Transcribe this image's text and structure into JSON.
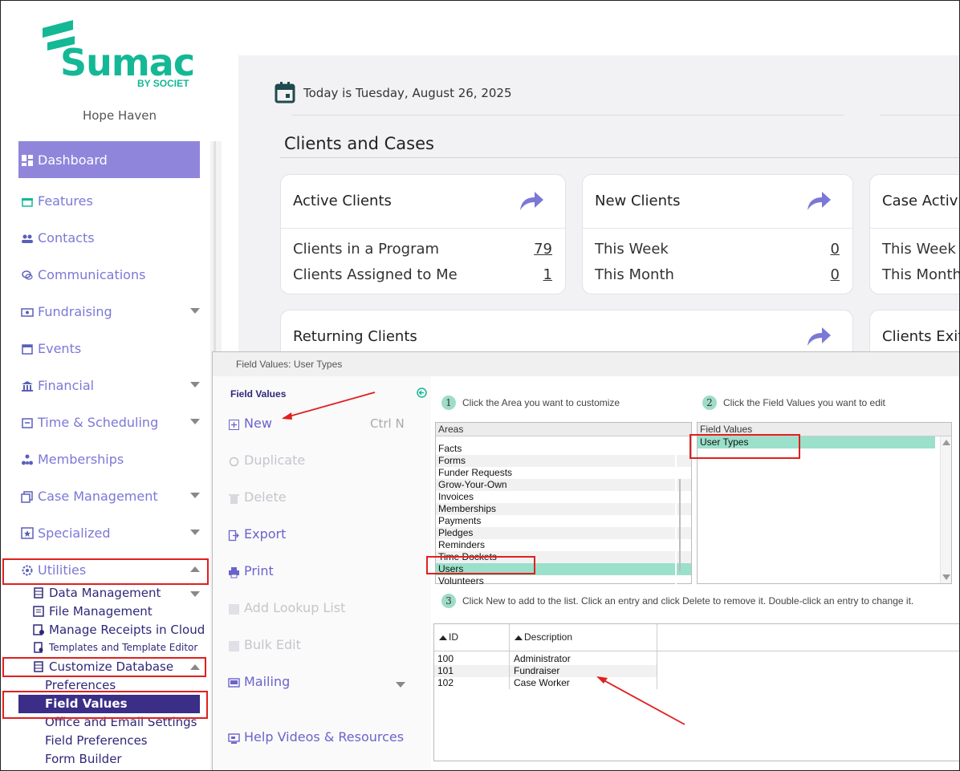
{
  "brand": {
    "name": "Sumac",
    "sub": "BY SOCIET",
    "color": "#14b895"
  },
  "org_name": "Hope Haven",
  "sidebar": {
    "items": [
      {
        "label": "Dashboard",
        "icon": "grid-icon"
      },
      {
        "label": "Features",
        "icon": "gift-icon"
      },
      {
        "label": "Contacts",
        "icon": "people-icon"
      },
      {
        "label": "Communications",
        "icon": "chat-icon"
      },
      {
        "label": "Fundraising",
        "icon": "money-icon"
      },
      {
        "label": "Events",
        "icon": "calendar-icon"
      },
      {
        "label": "Financial",
        "icon": "bank-icon"
      },
      {
        "label": "Time & Scheduling",
        "icon": "clock-calendar-icon"
      },
      {
        "label": "Memberships",
        "icon": "org-chart-icon"
      },
      {
        "label": "Case Management",
        "icon": "briefcase-icon"
      },
      {
        "label": "Specialized",
        "icon": "star-icon"
      },
      {
        "label": "Utilities",
        "icon": "gear-icon"
      }
    ],
    "utilities_sub": [
      "Data Management",
      "File Management",
      "Manage Receipts in Cloud",
      "Templates and Template Editor",
      "Customize Database"
    ],
    "customize_sub": [
      "Preferences",
      "Field Values",
      "Office and Email Settings",
      "Field Preferences",
      "Form Builder"
    ]
  },
  "dashboard": {
    "today": "Today is Tuesday, August 26, 2025",
    "section_title": "Clients and Cases",
    "cards": {
      "active": {
        "title": "Active Clients",
        "rows": [
          {
            "label": "Clients in a Program",
            "value": "79"
          },
          {
            "label": "Clients Assigned to Me",
            "value": "1"
          }
        ]
      },
      "new": {
        "title": "New Clients",
        "rows": [
          {
            "label": "This Week",
            "value": "0"
          },
          {
            "label": "This Month",
            "value": "0"
          }
        ]
      },
      "case": {
        "title": "Case Activit",
        "rows": [
          {
            "label": "This Week"
          },
          {
            "label": "This Month"
          }
        ]
      },
      "returning": {
        "title": "Returning Clients"
      },
      "exiting": {
        "title": "Clients Exiti"
      }
    }
  },
  "dialog": {
    "title": "Field Values: User Types",
    "panel_label": "Field Values",
    "actions": [
      {
        "label": "New",
        "shortcut": "Ctrl N",
        "enabled": true,
        "icon": "plus-box-icon"
      },
      {
        "label": "Duplicate",
        "enabled": false,
        "icon": "duplicate-icon"
      },
      {
        "label": "Delete",
        "enabled": false,
        "icon": "trash-icon"
      },
      {
        "label": "Export",
        "enabled": true,
        "icon": "export-icon"
      },
      {
        "label": "Print",
        "enabled": true,
        "icon": "printer-icon"
      },
      {
        "label": "Add Lookup List",
        "enabled": false,
        "icon": "lookup-list-icon"
      },
      {
        "label": "Bulk Edit",
        "enabled": false,
        "icon": "bulk-edit-icon"
      },
      {
        "label": "Mailing",
        "enabled": true,
        "icon": "mailing-icon"
      },
      {
        "label": "Help Videos & Resources",
        "enabled": true,
        "icon": "video-icon"
      }
    ],
    "step1": {
      "num": "1",
      "text": "Click the Area you want to customize"
    },
    "step2": {
      "num": "2",
      "text": "Click the Field Values you want to edit"
    },
    "step3": {
      "num": "3",
      "text": "Click New to add to the list. Click an entry and click Delete to remove it. Double-click an entry to change it."
    },
    "areas": {
      "header": "Areas",
      "items": [
        "Facts",
        "Forms",
        "Funder Requests",
        "Grow-Your-Own",
        "Invoices",
        "Memberships",
        "Payments",
        "Pledges",
        "Reminders",
        "Time Dockets",
        "Users",
        "Volunteers"
      ],
      "selected": "Users"
    },
    "field_values": {
      "header": "Field Values",
      "items": [
        "User Types"
      ],
      "selected": "User Types"
    },
    "table": {
      "columns": [
        "ID",
        "Description"
      ],
      "rows": [
        {
          "id": "100",
          "desc": "Administrator"
        },
        {
          "id": "101",
          "desc": "Fundraiser"
        },
        {
          "id": "102",
          "desc": "Case Worker"
        }
      ]
    }
  },
  "colors": {
    "accent": "#7b78d6",
    "dark_accent": "#3a2e87",
    "annotation": "#e0201e",
    "selection": "#9be0cb"
  }
}
